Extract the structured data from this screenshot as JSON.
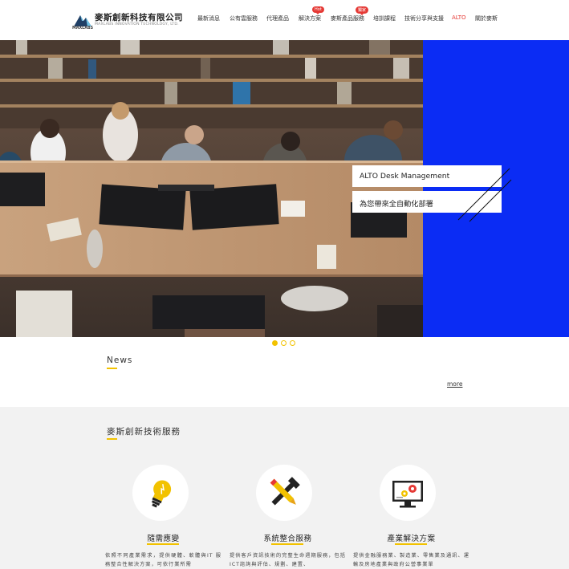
{
  "header": {
    "logo_name": "麥斯創新科技有限公司",
    "logo_subtitle": "MAXLABS INNOVATION TECHNOLOGY, LTD.",
    "logo_small": "MAXLABS",
    "nav": [
      {
        "label": "最新消息",
        "active": false
      },
      {
        "label": "公有雲服務",
        "active": false
      },
      {
        "label": "代理產品",
        "active": false
      },
      {
        "label": "解決方案",
        "active": false,
        "badge": "Hot"
      },
      {
        "label": "麥斯產品服務",
        "active": false,
        "badge": "獨家"
      },
      {
        "label": "培訓課程",
        "active": false
      },
      {
        "label": "技術分享與支援",
        "active": false
      },
      {
        "label": "ALTO",
        "active": true
      },
      {
        "label": "關於麥斯",
        "active": false
      }
    ]
  },
  "hero": {
    "caption_1": "ALTO Desk Management",
    "caption_2": "為您帶來全自動化部署",
    "slides": 3,
    "active_slide": 1
  },
  "news": {
    "title": "News",
    "more_label": "more"
  },
  "services": {
    "title": "麥斯創新技術服務",
    "cards": [
      {
        "icon": "lightbulb-icon",
        "title": "隨需應變",
        "desc": "依照不同產業需求，提供硬體、軟體與IT 服務整合性解決方案，可依行業所需"
      },
      {
        "icon": "tools-icon",
        "title": "系統整合服務",
        "desc": "提供客戶資訊技術的完整生命週期服務，包括ICT諮詢與評估、規劃、建置、"
      },
      {
        "icon": "monitor-gear-icon",
        "title": "產業解決方案",
        "desc": "提供金融服務業、製造業、零售業及通訊、運輸及房地產業與政府公營事業單"
      }
    ]
  },
  "colors": {
    "accent_yellow": "#f2c200",
    "hero_blue": "#0b2cf4",
    "active_red": "#e53935"
  }
}
